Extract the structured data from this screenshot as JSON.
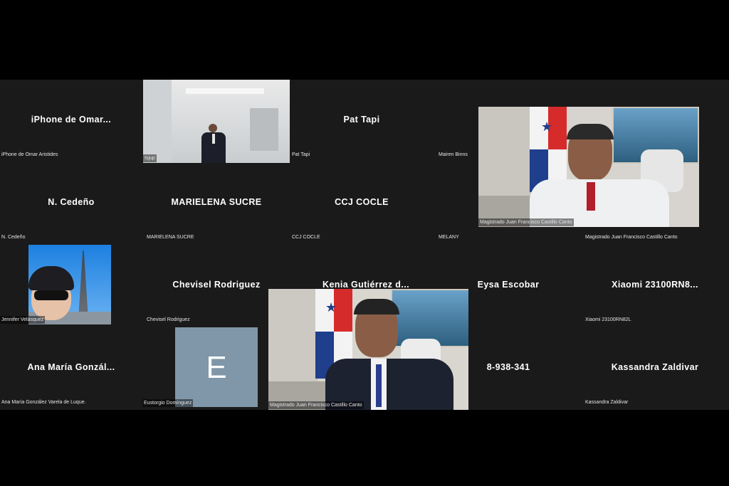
{
  "tiles": [
    {
      "id": "t1",
      "center": "iPhone de Omar...",
      "label": "iPhone de Omar Aristides"
    },
    {
      "id": "t2",
      "center": "",
      "label": "Isjup"
    },
    {
      "id": "t3",
      "center": "Pat Tapi",
      "label": "Pat Tapi"
    },
    {
      "id": "t4",
      "center": "",
      "label": "Mairen Binns"
    },
    {
      "id": "t5",
      "center": "",
      "label": "Magistrado Juan Francisco Castillo Canto"
    },
    {
      "id": "t6",
      "center": "N. Cedeño",
      "label": "N. Cedeño"
    },
    {
      "id": "t7",
      "center": "MARIELENA SUCRE",
      "label": "MARIELENA SUCRE"
    },
    {
      "id": "t8",
      "center": "CCJ COCLE",
      "label": "CCJ COCLE"
    },
    {
      "id": "t9",
      "center": "",
      "label": "MELANY"
    },
    {
      "id": "t10",
      "center": "",
      "label": "Magistrado Juan Francisco Castillo Canto"
    },
    {
      "id": "t11",
      "center": "",
      "label": "Jennifer Velásquez"
    },
    {
      "id": "t12",
      "center": "Chevisel Rodriguez",
      "label": "Chevisel Rodriguez"
    },
    {
      "id": "t13",
      "center": "Kenia Gutiérrez d...",
      "label": ""
    },
    {
      "id": "t14",
      "center": "Eysa Escobar",
      "label": ""
    },
    {
      "id": "t15",
      "center": "Xiaomi 23100RN8...",
      "label": "Xiaomi 23100RN82L"
    },
    {
      "id": "t16",
      "center": "Ana María Gonzál...",
      "label": "Ana María González Varela de Luque."
    },
    {
      "id": "t17",
      "center": "",
      "label": "Eustorgio Domínguez"
    },
    {
      "id": "t18",
      "center": "",
      "label": "Magistrado Juan Francisco Castillo Canto"
    },
    {
      "id": "t19",
      "center": "8-938-341",
      "label": ""
    },
    {
      "id": "t20",
      "center": "Kassandra Zaldivar",
      "label": "Kassandra Zaldivar"
    }
  ],
  "avatar_letter": "E",
  "colors": {
    "gallery_bg": "#1a1a1a",
    "letterbox": "#000000",
    "avatar": "#7f97a8"
  }
}
